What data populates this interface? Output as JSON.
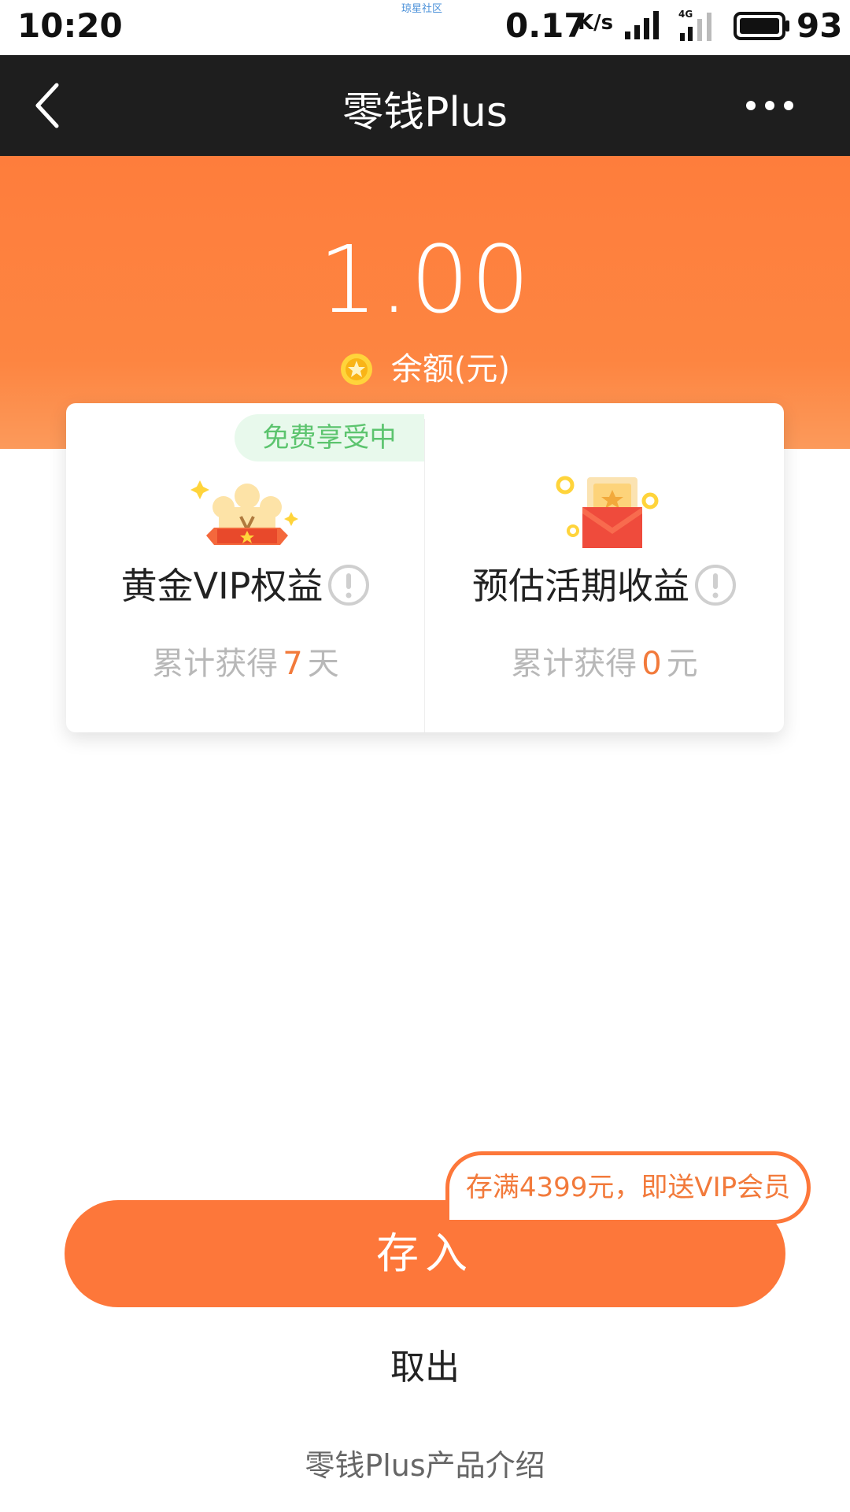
{
  "status_bar": {
    "time": "10:20",
    "tiny_text": "琼星社区",
    "speed": "0.17",
    "speed_unit": "K/s",
    "network": "4G",
    "battery": "93"
  },
  "nav": {
    "title": "零钱Plus"
  },
  "balance": {
    "amount": "1.00",
    "label": "余额(元)"
  },
  "cards": {
    "badge": "免费享受中",
    "left": {
      "title": "黄金VIP权益",
      "sub_prefix": "累计获得",
      "sub_value": "7",
      "sub_unit": "天"
    },
    "right": {
      "title": "预估活期收益",
      "sub_prefix": "累计获得",
      "sub_value": "0",
      "sub_unit": "元"
    }
  },
  "actions": {
    "promo": "存满4399元，即送VIP会员",
    "deposit": "存入",
    "withdraw": "取出",
    "intro": "零钱Plus产品介绍"
  },
  "colors": {
    "accent": "#fd773a",
    "nav_bg": "#1e1e1e",
    "badge_green": "#5cc46e"
  }
}
